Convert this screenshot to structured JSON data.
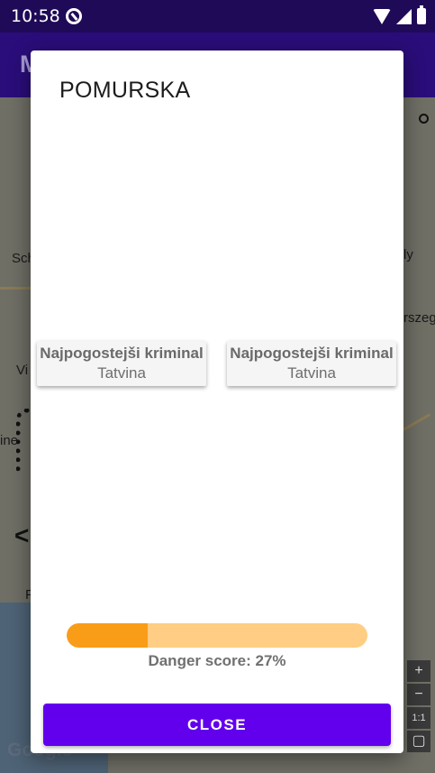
{
  "status_bar": {
    "time": "10:58",
    "app_icon": "tracking-icon",
    "icons": [
      "wifi-icon",
      "cell-signal-icon",
      "battery-icon"
    ]
  },
  "app_bar": {
    "title_initial": "M"
  },
  "map": {
    "labels": [
      "Sch",
      "ly",
      "Vi",
      "rszeg",
      "ine",
      "F"
    ],
    "zoom_in": "+",
    "zoom_out": "−",
    "scale": "1:1",
    "logo": "Google"
  },
  "dialog": {
    "title": "POMURSKA",
    "cards": [
      {
        "title": "Najpogostejši kriminal",
        "value": "Tatvina"
      },
      {
        "title": "Najpogostejši kriminal",
        "value": "Tatvina"
      }
    ],
    "danger_score_label": "Danger score: 27%",
    "danger_score_fraction": 0.27,
    "close_label": "CLOSE"
  },
  "colors": {
    "accent": "#6200ee",
    "progress_fill": "#f99d18",
    "progress_track": "#ffcd83",
    "app_bar": "#2a0d7a"
  }
}
